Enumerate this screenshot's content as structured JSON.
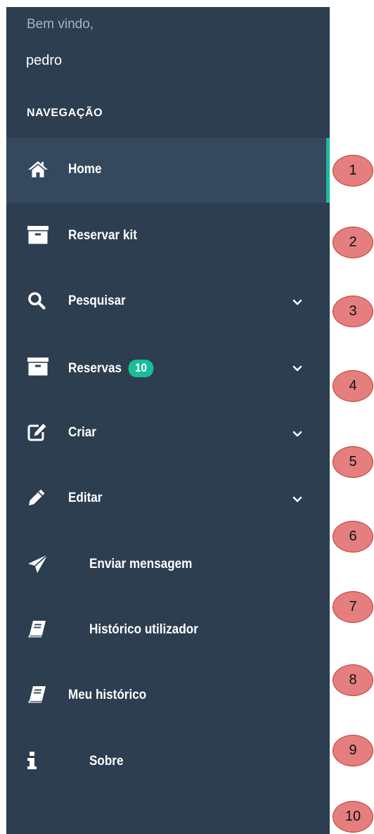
{
  "header": {
    "welcome": "Bem vindo,",
    "username": "pedro"
  },
  "nav": {
    "section_title": "NAVEGAÇÃO",
    "items": [
      {
        "label": "Home",
        "icon": "home-icon",
        "active": true
      },
      {
        "label": "Reservar kit",
        "icon": "archive-icon"
      },
      {
        "label": "Pesquisar",
        "icon": "search-icon",
        "has_submenu": true
      },
      {
        "label": "Reservas",
        "icon": "archive-icon",
        "badge": "10",
        "has_submenu": true
      },
      {
        "label": "Criar",
        "icon": "edit-square-icon",
        "has_submenu": true
      },
      {
        "label": "Editar",
        "icon": "pencil-icon",
        "has_submenu": true
      },
      {
        "label": "Enviar mensagem",
        "icon": "paper-plane-icon"
      },
      {
        "label": "Histórico utilizador",
        "icon": "book-icon"
      },
      {
        "label": "Meu histórico",
        "icon": "book-icon"
      },
      {
        "label": "Sobre",
        "icon": "info-icon"
      }
    ]
  },
  "callouts": [
    "1",
    "2",
    "3",
    "4",
    "5",
    "6",
    "7",
    "8",
    "9",
    "10"
  ],
  "colors": {
    "sidebar_bg": "#2c3e50",
    "active_bg": "#34495e",
    "accent": "#1abc9c",
    "callout_fill": "#e57e7e",
    "callout_border": "#c0392b"
  }
}
